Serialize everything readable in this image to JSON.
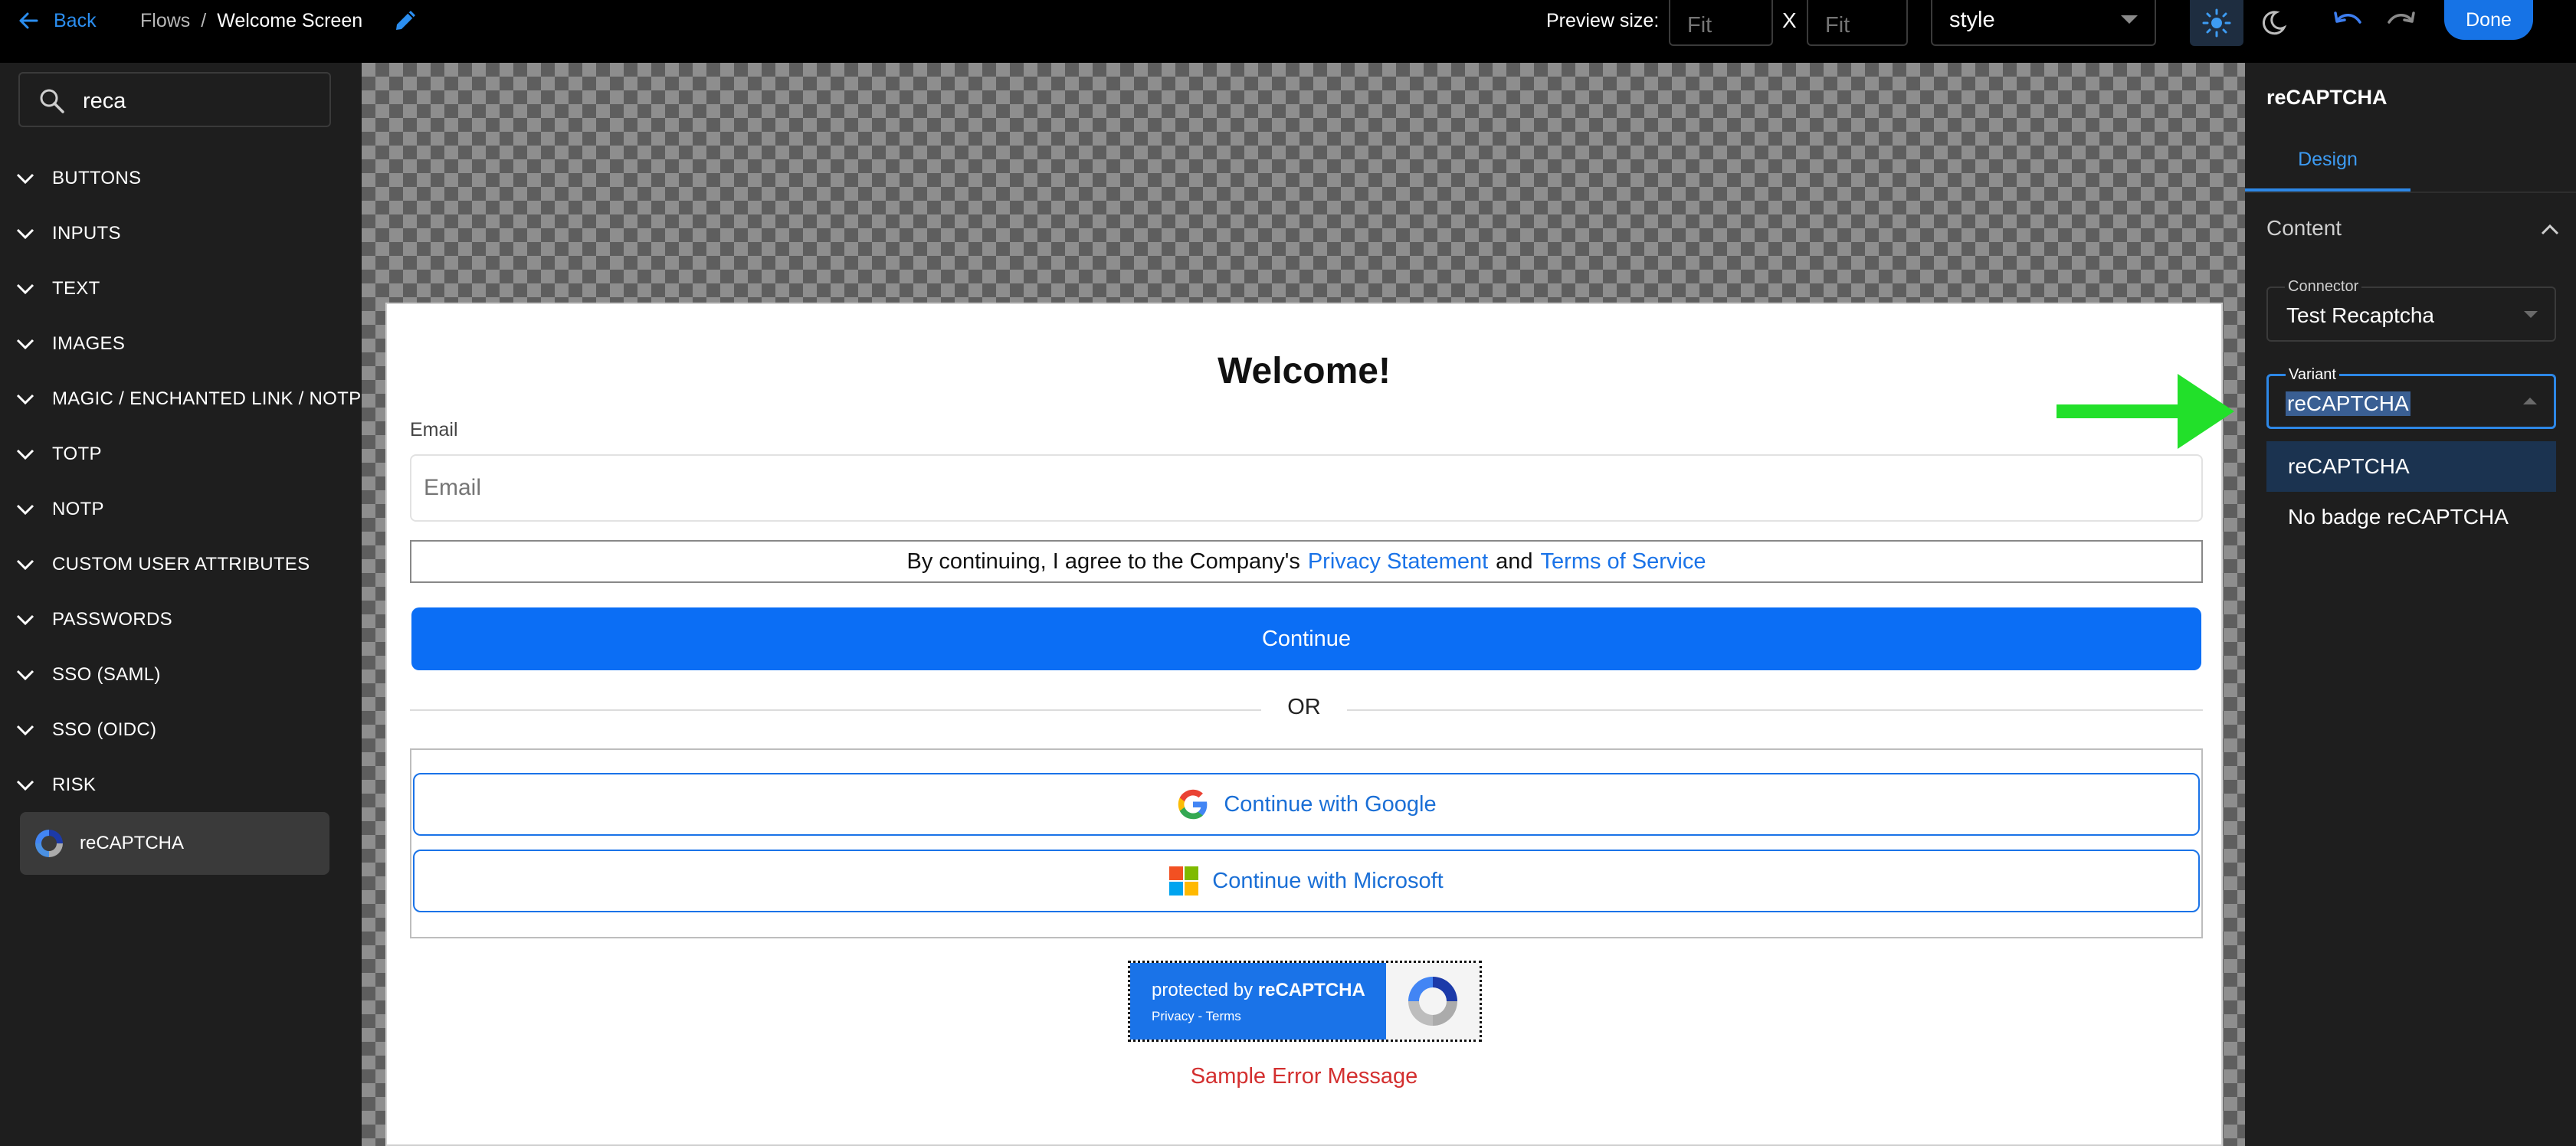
{
  "topbar": {
    "back_label": "Back",
    "breadcrumb": [
      "Flows",
      "/",
      "Welcome Screen"
    ],
    "preview_size_label": "Preview size:",
    "width_placeholder": "Fit",
    "height_placeholder": "Fit",
    "x_label": "X",
    "style_value": "style",
    "done_label": "Done"
  },
  "sidebar": {
    "search_value": "reca",
    "categories": [
      "BUTTONS",
      "INPUTS",
      "TEXT",
      "IMAGES",
      "MAGIC / ENCHANTED LINK / NOTP",
      "TOTP",
      "NOTP",
      "CUSTOM USER ATTRIBUTES",
      "PASSWORDS",
      "SSO (SAML)",
      "SSO (OIDC)",
      "RISK"
    ],
    "component_label": "reCAPTCHA"
  },
  "screen": {
    "title": "Welcome!",
    "email_label": "Email",
    "email_placeholder": "Email",
    "terms_prefix": "By continuing, I agree to the Company's",
    "privacy_link": "Privacy Statement",
    "and_text": "and",
    "tos_link": "Terms of Service",
    "continue_label": "Continue",
    "or_text": "OR",
    "google_label": "Continue with Google",
    "microsoft_label": "Continue with Microsoft",
    "recaptcha_prefix": "protected by",
    "recaptcha_brand": "reCAPTCHA",
    "recaptcha_links": "Privacy - Terms",
    "error_message": "Sample Error Message"
  },
  "right_panel": {
    "title": "reCAPTCHA",
    "tab_label": "Design",
    "section_label": "Content",
    "connector_label": "Connector",
    "connector_value": "Test Recaptcha",
    "variant_label": "Variant",
    "variant_value": "reCAPTCHA",
    "variant_options": [
      "reCAPTCHA",
      "No badge reCAPTCHA"
    ]
  },
  "colors": {
    "accent": "#1673e6",
    "primary_button": "#0b6ef5",
    "link": "#1a73e8",
    "error": "#d32f2f",
    "arrow": "#22e02a"
  }
}
